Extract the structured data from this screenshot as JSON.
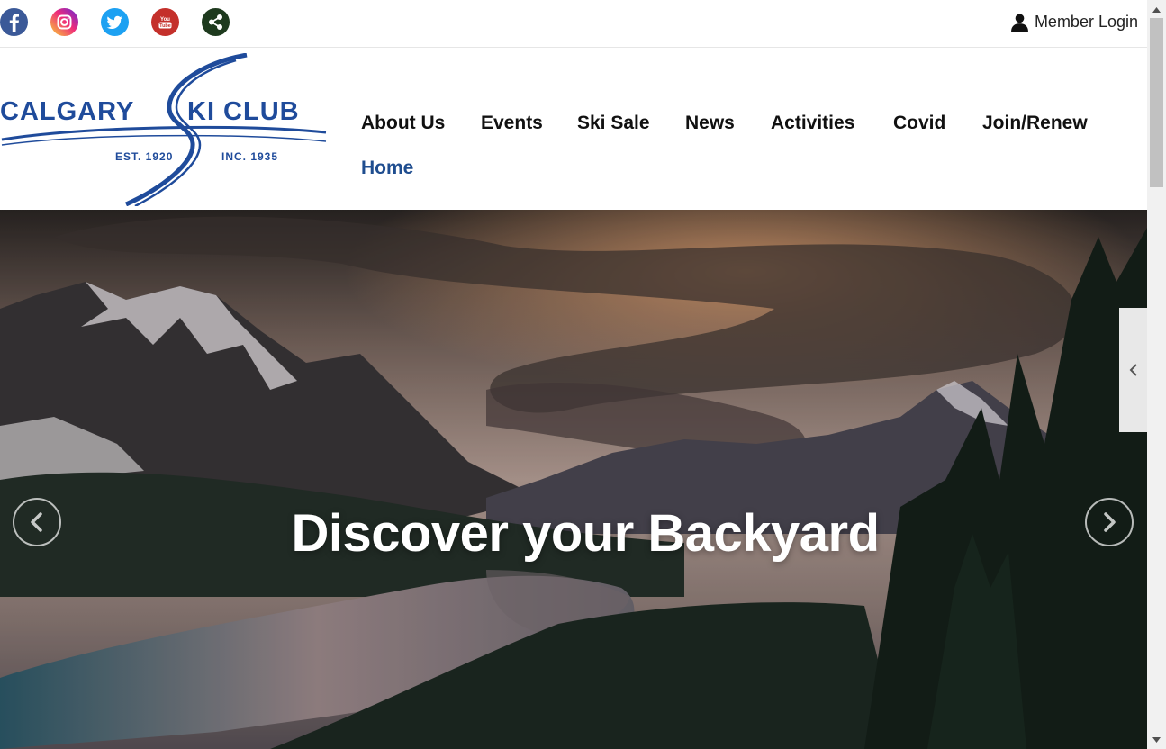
{
  "social": {
    "items": [
      {
        "name": "facebook",
        "color": "#3b5998",
        "icon": "facebook-icon"
      },
      {
        "name": "instagram",
        "color": "#d6249f",
        "icon": "instagram-icon"
      },
      {
        "name": "twitter",
        "color": "#1da1f2",
        "icon": "twitter-icon"
      },
      {
        "name": "youtube",
        "color": "#c4302b",
        "icon": "youtube-icon",
        "label_top": "You",
        "label_bottom": "Tube"
      },
      {
        "name": "share",
        "color": "#1e3a1e",
        "icon": "share-icon"
      }
    ]
  },
  "login": {
    "label": "Member Login",
    "icon": "user-icon"
  },
  "logo": {
    "left_text": "CALGARY",
    "right_text": "KI CLUB",
    "est": "EST. 1920",
    "inc": "INC. 1935",
    "color": "#1f4b9b"
  },
  "nav": {
    "items": [
      {
        "label": "About Us"
      },
      {
        "label": "Events"
      },
      {
        "label": "Ski Sale"
      },
      {
        "label": "News"
      },
      {
        "label": "Activities"
      },
      {
        "label": "Covid"
      },
      {
        "label": "Join/Renew"
      },
      {
        "label": "Home",
        "active": true
      }
    ],
    "active_color": "#1f4d8f"
  },
  "hero": {
    "title": "Discover your Backyard",
    "prev_icon": "chevron-left-icon",
    "next_icon": "chevron-right-icon",
    "side_tab_icon": "chevron-left-icon"
  }
}
